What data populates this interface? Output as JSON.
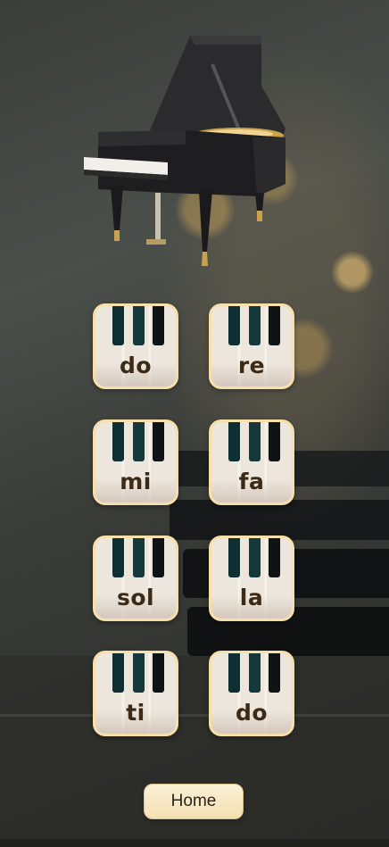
{
  "notes": [
    {
      "label": "do"
    },
    {
      "label": "re"
    },
    {
      "label": "mi"
    },
    {
      "label": "fa"
    },
    {
      "label": "sol"
    },
    {
      "label": "la"
    },
    {
      "label": "ti"
    },
    {
      "label": "do"
    }
  ],
  "home_label": "Home",
  "colors": {
    "button_border": "#f6dfa9",
    "black_key": "#0f2f33",
    "note_text": "#3c2a16",
    "home_bg": "#fbf0d6"
  },
  "icons": {
    "hero": "grand-piano-illustration"
  }
}
